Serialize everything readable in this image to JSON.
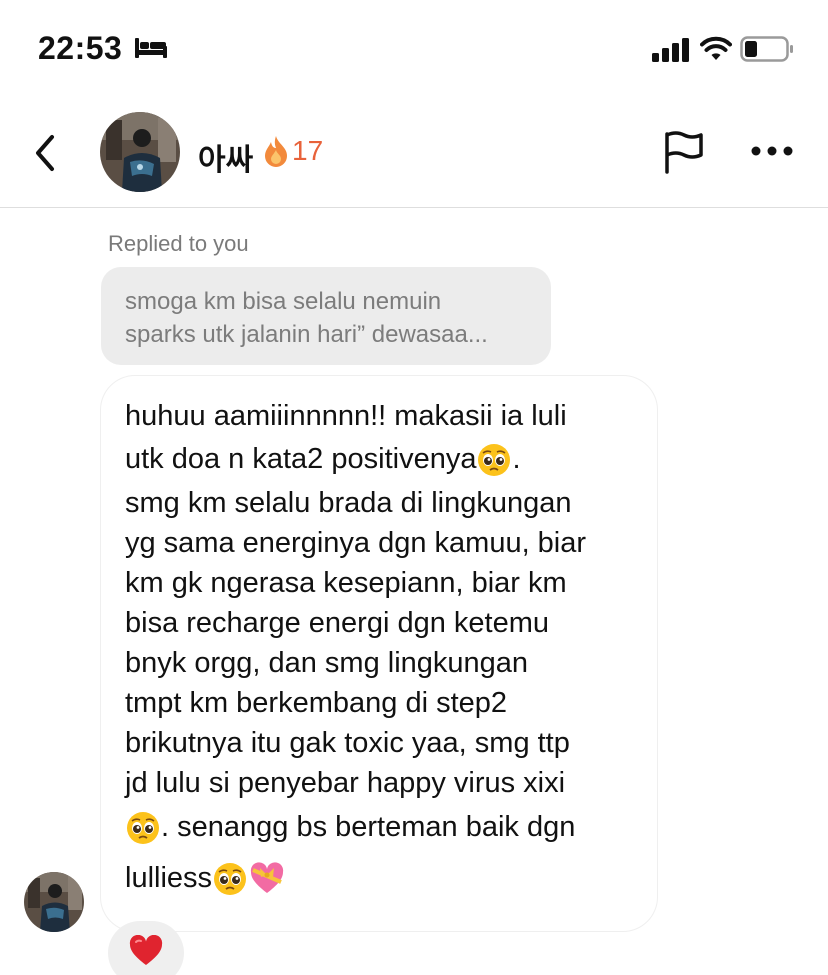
{
  "status_bar": {
    "time": "22:53",
    "icons": [
      "sleep-mode-icon",
      "cellular-signal-icon",
      "wifi-icon",
      "battery-icon"
    ]
  },
  "header": {
    "back_icon": "chevron-left-icon",
    "contact_name": "아싸",
    "streak_icon": "fire-icon",
    "streak_count": "17",
    "flag_icon": "flag-icon",
    "more_icon": "more-horizontal-icon"
  },
  "reply": {
    "label": "Replied to you",
    "quoted_lines": [
      "smoga km bisa selalu nemuin",
      "sparks utk jalanin hari” dewasaa..."
    ]
  },
  "message": {
    "lines": [
      "huhuu aamiiinnnnn!! makasii ia luli",
      "utk doa n kata2 positivenya",
      ".",
      "smg km selalu brada di lingkungan",
      "yg sama energinya dgn kamuu, biar",
      "km gk ngerasa kesepiann, biar km",
      "bisa recharge energi dgn ketemu",
      "bnyk orgg, dan smg lingkungan",
      "tmpt km berkembang di step2",
      "brikutnya itu gak toxic yaa, smg ttp",
      "jd lulu si penyebar happy virus xixi",
      ". senangg bs berteman baik dgn",
      "lulliess"
    ],
    "emoji_names": [
      "pleading-face-emoji",
      "heart-with-ribbon-emoji"
    ]
  },
  "reaction": {
    "icon": "red-heart-icon",
    "color": "#e0242f"
  },
  "colors": {
    "streak": "#e8623a",
    "quoted_bubble_bg": "#ececec",
    "muted_text": "#7a7a7a"
  }
}
